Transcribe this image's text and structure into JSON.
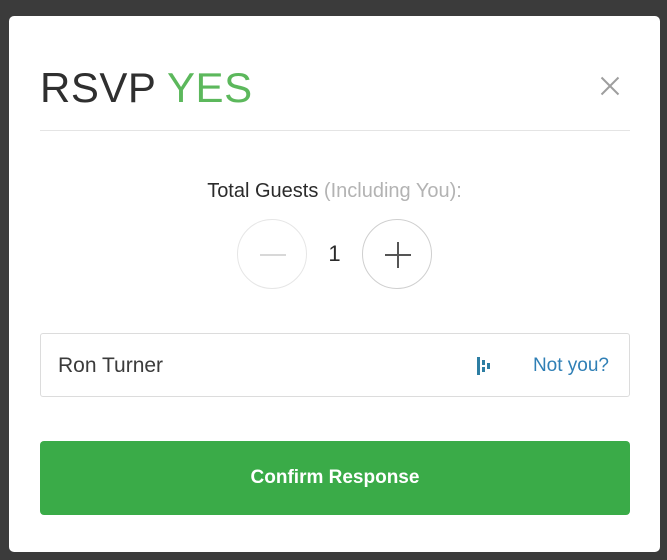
{
  "modal": {
    "title_prefix": "RSVP",
    "title_status": "YES",
    "close_icon": "close-icon"
  },
  "guests": {
    "label": "Total Guests",
    "label_note": "(Including You):",
    "count": "1",
    "decrement_icon": "minus-icon",
    "increment_icon": "plus-icon"
  },
  "attendee": {
    "name": "Ron Turner",
    "service_icon": "brand-icon",
    "not_you_label": "Not you?"
  },
  "actions": {
    "confirm_label": "Confirm Response"
  },
  "colors": {
    "accent_green": "#5cb85c",
    "button_green": "#3aab48",
    "link_blue": "#2f7fb5"
  }
}
